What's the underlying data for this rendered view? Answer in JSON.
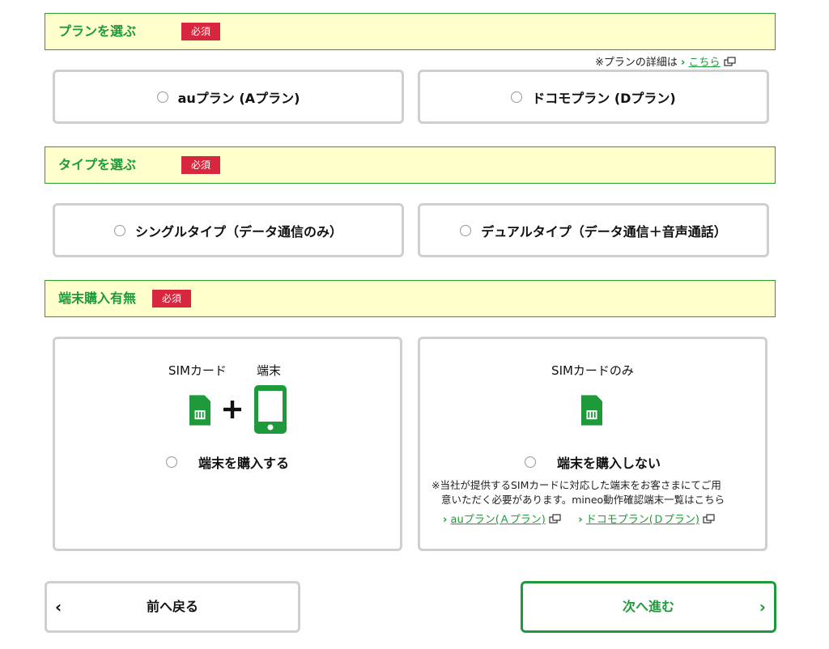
{
  "section_plan": {
    "title": "プランを選ぶ",
    "required": "必須",
    "note": "※プランの詳細は",
    "note_link": "こちら",
    "options": [
      {
        "label": "auプラン (Aプラン)"
      },
      {
        "label": "ドコモプラン (Dプラン)"
      }
    ]
  },
  "section_type": {
    "title": "タイプを選ぶ",
    "required": "必須",
    "options": [
      {
        "label": "シングルタイプ（データ通信のみ）"
      },
      {
        "label": "デュアルタイプ（データ通信＋音声通話）"
      }
    ]
  },
  "section_device": {
    "title": "端末購入有無",
    "required": "必須",
    "option_buy": {
      "caption_sim": "SIMカード",
      "caption_device": "端末",
      "label": "端末を購入する"
    },
    "option_nobuy": {
      "caption": "SIMカードのみ",
      "label": "端末を購入しない",
      "note_line1": "※当社が提供するSIMカードに対応した端末をお客さまにてご用",
      "note_line2": "意いただく必要があります。mineo動作確認端末一覧はこちら",
      "link_au": "auプラン(Ａプラン)",
      "link_docomo": "ドコモプラン(Ｄプラン)"
    }
  },
  "nav": {
    "back_label": "前へ戻る",
    "next_label": "次へ進む"
  },
  "colors": {
    "accent": "#1e9a3a",
    "header_bg": "#ffffcc",
    "badge": "#d7263d",
    "border": "#cfcfcf"
  },
  "icons": [
    "sim-card-icon",
    "plus-icon",
    "smartphone-icon",
    "external-link-icon",
    "chevron-right-icon",
    "chevron-left-icon"
  ]
}
